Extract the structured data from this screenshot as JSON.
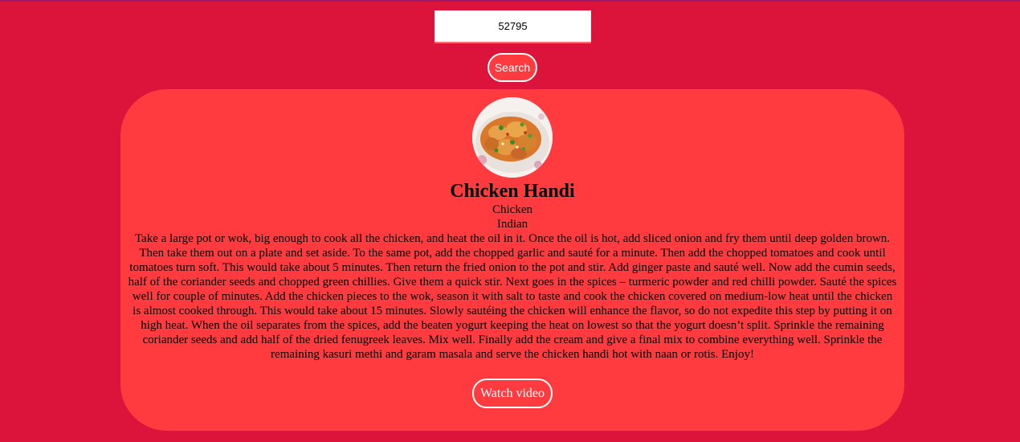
{
  "search": {
    "value": "52795",
    "button_label": "Search"
  },
  "meal": {
    "name": "Chicken Handi",
    "category": "Chicken",
    "area": "Indian",
    "instructions": "Take a large pot or wok, big enough to cook all the chicken, and heat the oil in it. Once the oil is hot, add sliced onion and fry them until deep golden brown. Then take them out on a plate and set aside. To the same pot, add the chopped garlic and sauté for a minute. Then add the chopped tomatoes and cook until tomatoes turn soft. This would take about 5 minutes. Then return the fried onion to the pot and stir. Add ginger paste and sauté well. Now add the cumin seeds, half of the coriander seeds and chopped green chillies. Give them a quick stir. Next goes in the spices – turmeric powder and red chilli powder. Sauté the spices well for couple of minutes. Add the chicken pieces to the wok, season it with salt to taste and cook the chicken covered on medium-low heat until the chicken is almost cooked through. This would take about 15 minutes. Slowly sautéing the chicken will enhance the flavor, so do not expedite this step by putting it on high heat. When the oil separates from the spices, add the beaten yogurt keeping the heat on lowest so that the yogurt doesn’t split. Sprinkle the remaining coriander seeds and add half of the dried fenugreek leaves. Mix well. Finally add the cream and give a final mix to combine everything well. Sprinkle the remaining kasuri methi and garam masala and serve the chicken handi hot with naan or rotis. Enjoy!",
    "video_label": "Watch video"
  },
  "colors": {
    "page_background": "#dc143c",
    "card_background": "#ff3b3f",
    "button_border": "#ffffff"
  }
}
